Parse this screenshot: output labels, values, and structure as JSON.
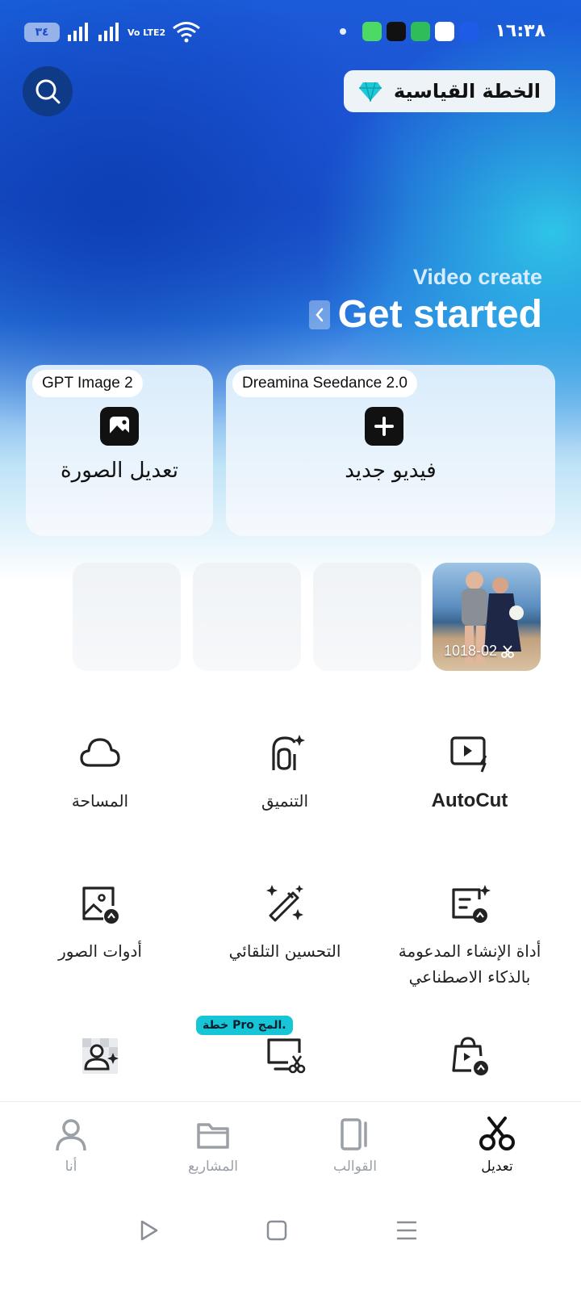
{
  "status_bar": {
    "time": "١٦:٣٨",
    "battery": "٣٤",
    "network": "Vo LTE2"
  },
  "header": {
    "plan_label": "الخطة القياسية"
  },
  "hero": {
    "subtitle": "Video create",
    "title": "Get started"
  },
  "cards": [
    {
      "badge": "GPT Image 2",
      "title": "تعديل الصورة",
      "icon": "image-icon"
    },
    {
      "badge": "Dreamina Seedance 2.0",
      "title": "فيديو جديد",
      "icon": "plus-icon"
    }
  ],
  "recent": {
    "first_label": "1018-02"
  },
  "tools": {
    "row1": [
      "AutoCut",
      "التنميق",
      "المساحة"
    ],
    "row2": [
      "أداة الإنشاء المدعومة بالذكاء الاصطناعي",
      "التحسين التلقائي",
      "أدوات الصور"
    ],
    "pro_badge": "خطة Pro المج."
  },
  "bottom_nav": [
    {
      "label": "تعديل",
      "icon": "scissors-icon",
      "active": true
    },
    {
      "label": "القوالب",
      "icon": "templates-icon",
      "active": false
    },
    {
      "label": "المشاريع",
      "icon": "folder-icon",
      "active": false
    },
    {
      "label": "أنا",
      "icon": "person-icon",
      "active": false
    }
  ],
  "colors": {
    "hero_blue": "#1a4fc8",
    "accent_cyan": "#17c6d6",
    "search_bg": "#0f3a86"
  }
}
